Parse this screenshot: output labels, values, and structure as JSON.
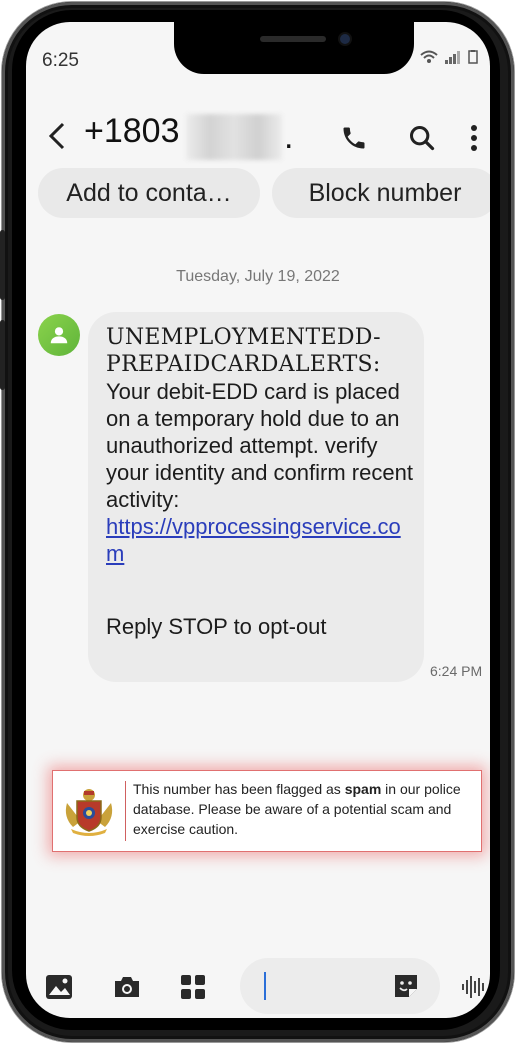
{
  "status_bar": {
    "time": "6:25",
    "icons": [
      "wifi-icon",
      "signal-icon",
      "battery-icon"
    ]
  },
  "header": {
    "contact_number": "+1803",
    "trailing": ".",
    "back_icon": "back-arrow-icon",
    "actions": [
      "phone-icon",
      "search-icon",
      "more-vert-icon"
    ]
  },
  "chips": {
    "add_contact": "Add to conta…",
    "block_number": "Block number"
  },
  "conversation": {
    "date": "Tuesday, July 19, 2022",
    "message": {
      "sender_line1": "UNEMPLOYMENTEDD-",
      "sender_line2": "PREPAIDCARDALERTS:",
      "body": "Your debit-EDD card is placed on a temporary hold due to an unauthorized attempt. verify your identity and confirm recent activity:",
      "link": "https://vpprocessingservice.com",
      "footer": "Reply STOP to opt-out",
      "time": "6:24 PM"
    }
  },
  "spam_alert": {
    "text_before": "This number has been flagged as ",
    "text_bold": "spam",
    "text_after": " in our police database. Please be aware of a potential scam and exercise caution.",
    "accent_color": "#e05050"
  },
  "bottom_bar": {
    "icons": [
      "gallery-icon",
      "camera-icon",
      "apps-icon",
      "sticker-icon",
      "voice-icon"
    ]
  },
  "colors": {
    "link": "#2a3dbb",
    "bubble": "#ebebeb",
    "avatar": "#6dbf3f"
  }
}
